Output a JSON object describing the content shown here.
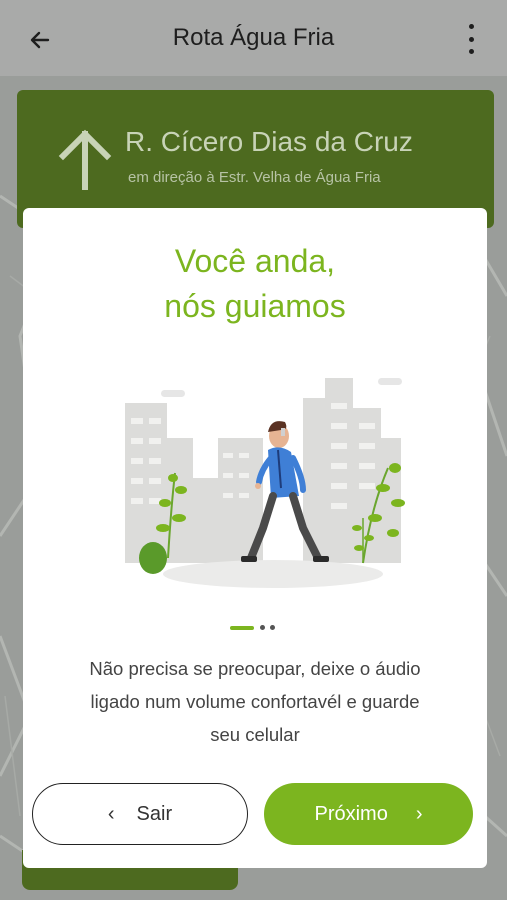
{
  "app_bar": {
    "title": "Rota Água Fria",
    "back_icon": "arrow-left-icon",
    "menu_icon": "more-vert-icon"
  },
  "navigation": {
    "direction_icon": "arrow-up-icon",
    "street": "R. Cícero Dias da Cruz",
    "toward": "em direção à Estr. Velha de Água Fria"
  },
  "onboarding": {
    "headline_line1": "Você anda,",
    "headline_line2": "nós guiamos",
    "page_indicator": {
      "current": 1,
      "total": 3
    },
    "description_lines": [
      "Não precisa se preocupar, deixe o áudio",
      "ligado num volume confortavél e guarde",
      "seu celular"
    ],
    "exit_label": "Sair",
    "next_label": "Próximo"
  },
  "colors": {
    "brand_green": "#7cb51f",
    "nav_card_green": "#4d6a1f",
    "appbar_bg": "#a9aaa9"
  }
}
